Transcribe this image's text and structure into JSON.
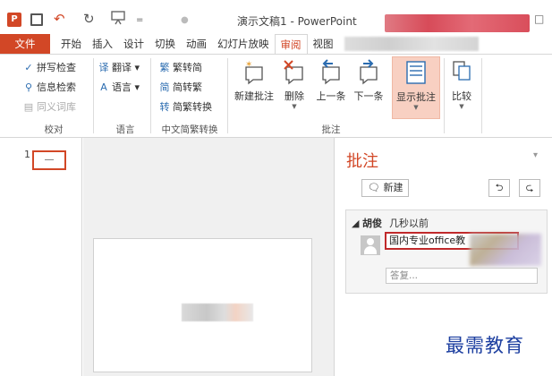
{
  "titlebar": {
    "app_icon": "P",
    "title": "演示文稿1 - PowerPoint",
    "undo_glyph": "↶",
    "redo_glyph": "↻",
    "more_glyph": "=",
    "icons": [
      "powerpoint-app-icon",
      "save-icon",
      "undo-icon",
      "redo-icon",
      "start-from-beginning-icon"
    ]
  },
  "tabs": [
    "文件",
    "开始",
    "插入",
    "设计",
    "切换",
    "动画",
    "幻灯片放映",
    "审阅",
    "视图"
  ],
  "active_tab": "审阅",
  "ribbon": {
    "proofing": {
      "label": "校对",
      "items": [
        "拼写检查",
        "信息检索",
        "同义词库"
      ]
    },
    "language": {
      "label": "语言",
      "items": [
        "翻译",
        "语言"
      ]
    },
    "chinese_conversion": {
      "label": "中文简繁转换",
      "items": [
        "繁转简",
        "简转繁",
        "简繁转换"
      ]
    },
    "comments": {
      "label": "批注",
      "items": [
        "新建批注",
        "删除",
        "上一条",
        "下一条",
        "显示批注"
      ]
    },
    "compare": {
      "label": "比较"
    }
  },
  "thumbnails": {
    "slide_number": "1"
  },
  "comments_pane": {
    "title": "批注",
    "new_button": "新建",
    "comment": {
      "author": "胡俊",
      "time": "几秒以前",
      "text": "国内专业office教",
      "reply_placeholder": "答复..."
    }
  },
  "watermark": "最需教育",
  "colors": {
    "accent": "#d24726",
    "comment_highlight": "#c0292b",
    "watermark": "#1d3fa0"
  }
}
